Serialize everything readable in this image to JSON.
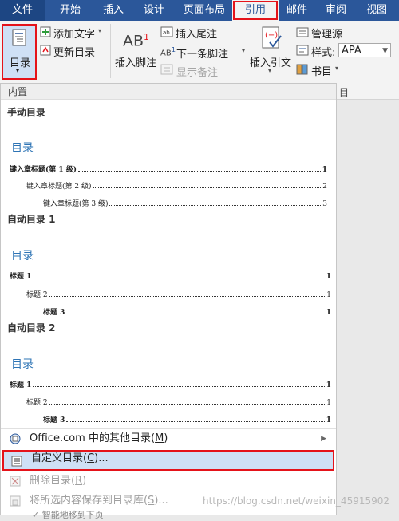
{
  "tabs": [
    {
      "label": "文件"
    },
    {
      "label": "开始"
    },
    {
      "label": "插入"
    },
    {
      "label": "设计"
    },
    {
      "label": "页面布局"
    },
    {
      "label": "引用"
    },
    {
      "label": "邮件"
    },
    {
      "label": "审阅"
    },
    {
      "label": "视图"
    }
  ],
  "ribbon": {
    "toc_label": "目录",
    "add_text": "添加文字",
    "update_toc": "更新目录",
    "insert_footnote_icon": "AB",
    "insert_footnote_sup": "1",
    "insert_footnote": "插入脚注",
    "insert_endnote": "插入尾注",
    "next_footnote": "下一条脚注",
    "show_notes": "显示备注",
    "insert_citation": "插入引文",
    "manage_sources": "管理源",
    "style_label": "样式:",
    "style_value": "APA",
    "bibliography": "书目",
    "group_label": "目"
  },
  "panel": {
    "section_header": "内置",
    "manual": {
      "name": "手动目录",
      "title": "目录",
      "entries": [
        {
          "text": "键入章标题(第 1 级)",
          "page": "1"
        },
        {
          "text": "键入章标题(第 2 级)",
          "page": "2"
        },
        {
          "text": "键入章标题(第 3 级)",
          "page": "3"
        }
      ]
    },
    "auto1": {
      "name": "自动目录 1",
      "title": "目录",
      "entries": [
        {
          "text": "标题 1",
          "page": "1"
        },
        {
          "text": "标题 2",
          "page": "1"
        },
        {
          "text": "标题 3",
          "page": "1"
        }
      ]
    },
    "auto2": {
      "name": "自动目录 2",
      "title": "目录",
      "entries": [
        {
          "text": "标题 1",
          "page": "1"
        },
        {
          "text": "标题 2",
          "page": "1"
        },
        {
          "text": "标题 3",
          "page": "1"
        }
      ]
    },
    "menu": {
      "more_pre": "Office.com 中的其他目录(",
      "more_key": "M",
      "more_post": ")",
      "custom_pre": "自定义目录(",
      "custom_key": "C",
      "custom_post": ")...",
      "delete_pre": "删除目录(",
      "delete_key": "R",
      "delete_post": ")",
      "save_pre": "将所选内容保存到目录库(",
      "save_key": "S",
      "save_post": ")..."
    }
  },
  "watermark": "https://blog.csdn.net/weixin_45915902",
  "below_text": "✓ 智能地移到下页"
}
